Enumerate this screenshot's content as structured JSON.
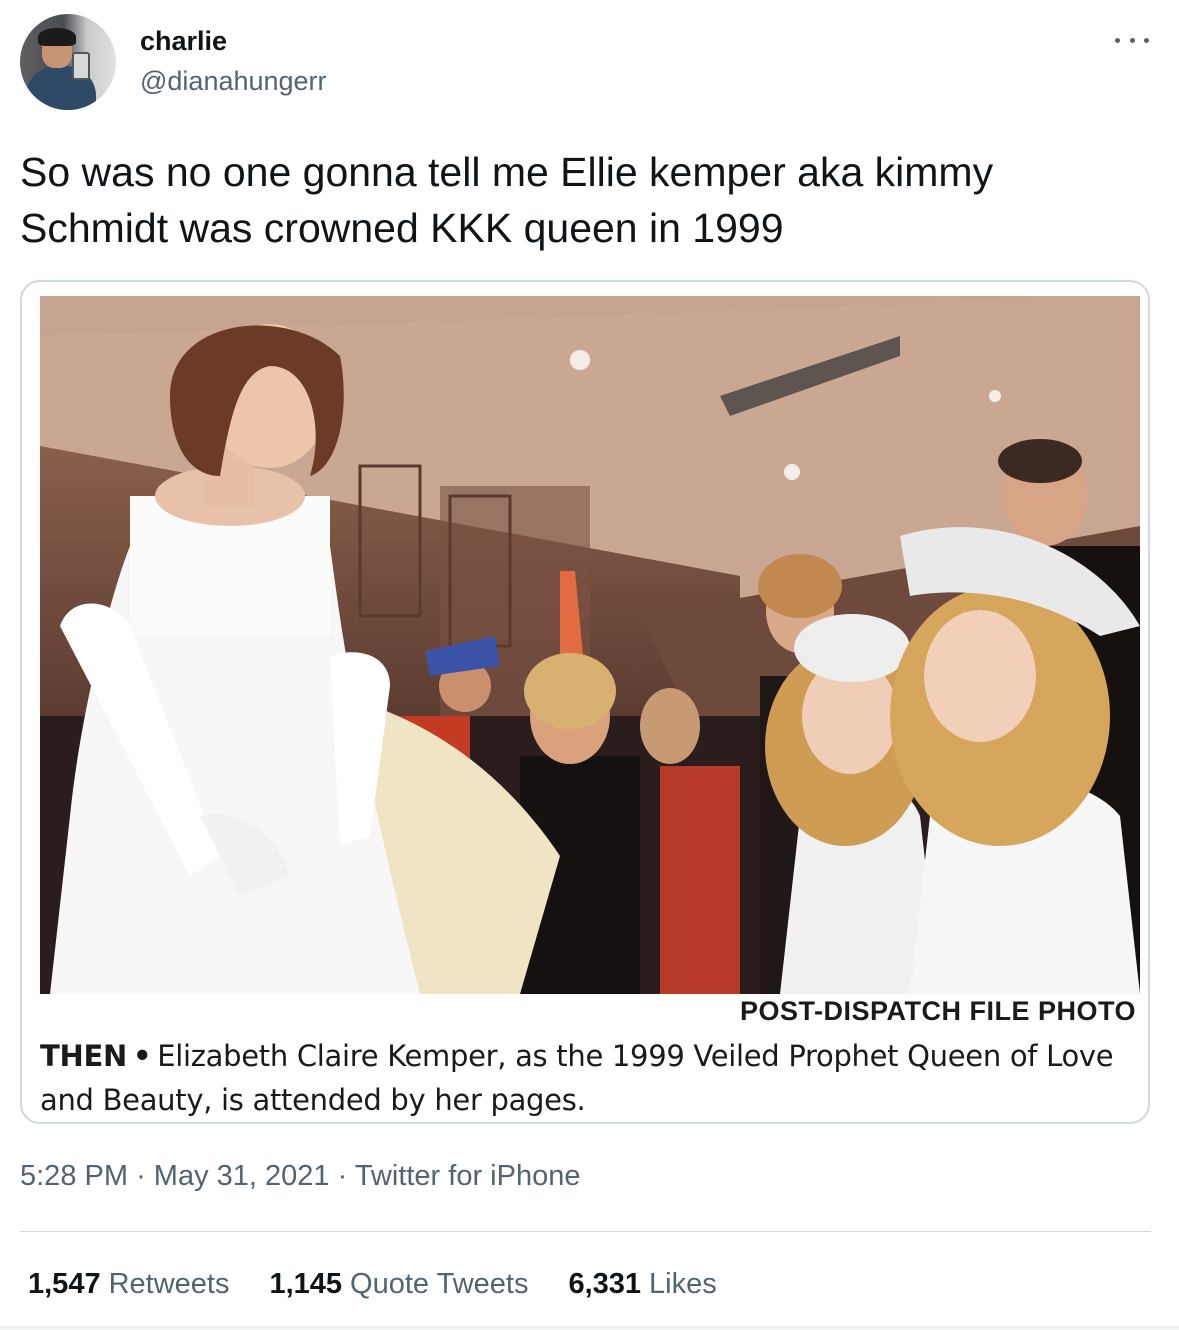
{
  "author": {
    "display_name": "charlie",
    "handle": "@dianahungerr",
    "avatar_icon": "profile-photo"
  },
  "more_icon": "ellipsis-icon",
  "tweet": {
    "text": "So was no one gonna tell me Ellie kemper aka kimmy Schmidt was crowned KKK queen in 1999"
  },
  "media": {
    "photo_credit": "POST-DISPATCH FILE PHOTO",
    "caption_lead": "THEN",
    "caption_bullet": "•",
    "caption_text": "Elizabeth Claire Kemper, as the 1999 Veiled Prophet Queen of Love and Beauty, is attended by her pages."
  },
  "meta": {
    "time": "5:28 PM",
    "separator": "·",
    "date": "May 31, 2021",
    "source": "Twitter for iPhone"
  },
  "stats": [
    {
      "count": "1,547",
      "label": "Retweets"
    },
    {
      "count": "1,145",
      "label": "Quote Tweets"
    },
    {
      "count": "6,331",
      "label": "Likes"
    }
  ],
  "colors": {
    "text_primary": "#0f1419",
    "text_secondary": "#536471",
    "border": "#cfd9de"
  }
}
